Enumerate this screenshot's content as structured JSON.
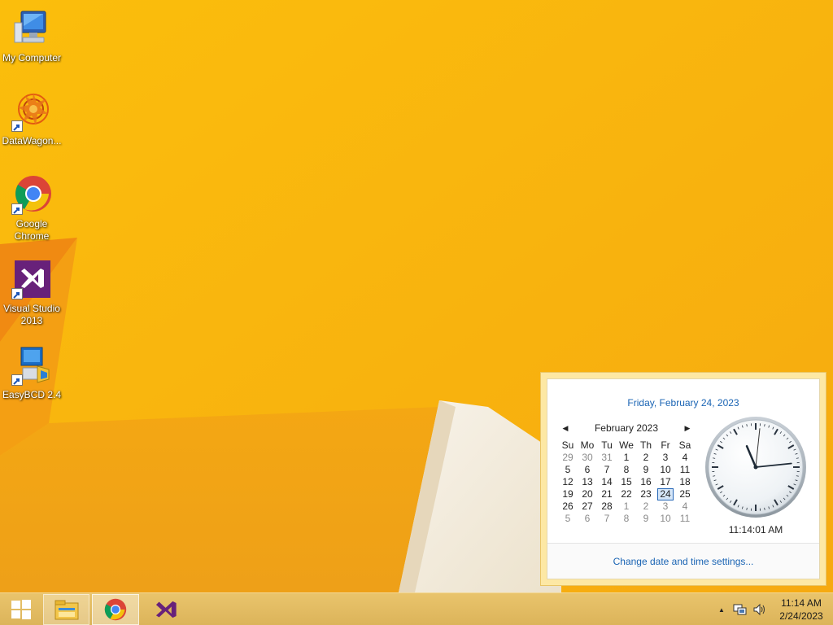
{
  "desktop": {
    "icons": [
      {
        "label": "My Computer"
      },
      {
        "label": "DataWagon..."
      },
      {
        "label": "Google Chrome"
      },
      {
        "label": "Visual Studio 2013"
      },
      {
        "label": "EasyBCD 2.4"
      }
    ]
  },
  "flyout": {
    "long_date": "Friday, February 24, 2023",
    "month_label": "February 2023",
    "prev_glyph": "◀",
    "next_glyph": "▶",
    "weekdays": [
      "Su",
      "Mo",
      "Tu",
      "We",
      "Th",
      "Fr",
      "Sa"
    ],
    "weeks": [
      [
        "29",
        "30",
        "31",
        "1",
        "2",
        "3",
        "4"
      ],
      [
        "5",
        "6",
        "7",
        "8",
        "9",
        "10",
        "11"
      ],
      [
        "12",
        "13",
        "14",
        "15",
        "16",
        "17",
        "18"
      ],
      [
        "19",
        "20",
        "21",
        "22",
        "23",
        "24",
        "25"
      ],
      [
        "26",
        "27",
        "28",
        "1",
        "2",
        "3",
        "4"
      ],
      [
        "5",
        "6",
        "7",
        "8",
        "9",
        "10",
        "11"
      ]
    ],
    "selected_day": "24",
    "clock_time": "11:14:01 AM",
    "clock_hands": {
      "hour": 11,
      "minute": 14,
      "second": 1
    },
    "settings_link": "Change date and time settings..."
  },
  "taskbar": {
    "pinned": [
      "start-icon",
      "file-explorer-icon",
      "chrome-icon",
      "visual-studio-icon"
    ],
    "tray_time": "11:14 AM",
    "tray_date": "2/24/2023",
    "tray_arrow": "▲"
  },
  "colors": {
    "wallpaper": "#f7b80a",
    "taskbar": "#e2bc62",
    "link": "#1a64b4",
    "vs_purple": "#68217a"
  }
}
